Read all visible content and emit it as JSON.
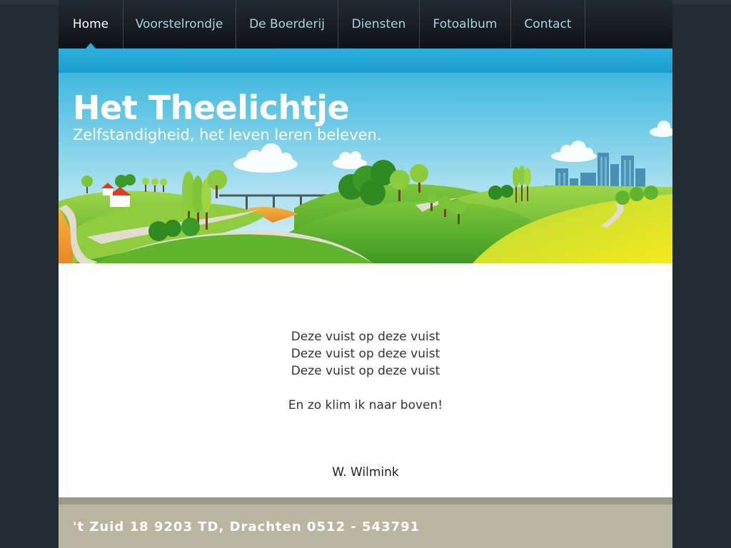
{
  "nav": {
    "items": [
      {
        "label": "Home",
        "active": true
      },
      {
        "label": "Voorstelrondje",
        "active": false
      },
      {
        "label": "De Boerderij",
        "active": false
      },
      {
        "label": "Diensten",
        "active": false
      },
      {
        "label": "Fotoalbum",
        "active": false
      },
      {
        "label": "Contact",
        "active": false
      }
    ]
  },
  "header": {
    "title": "Het Theelichtje",
    "tagline": "Zelfstandigheid, het leven leren beleven."
  },
  "content": {
    "poem_lines": [
      "Deze vuist op deze vuist",
      "Deze vuist op deze vuist",
      "Deze vuist op deze vuist",
      "En zo klim ik naar boven!"
    ],
    "author": "W. Wilmink"
  },
  "footer": {
    "address": "'t Zuid 18 9203 TD, Drachten 0512 - 543791"
  },
  "colors": {
    "background": "#222c35",
    "nav_text": "#a8d4e4",
    "accent": "#27aede",
    "footer": "#b8b6a0"
  }
}
